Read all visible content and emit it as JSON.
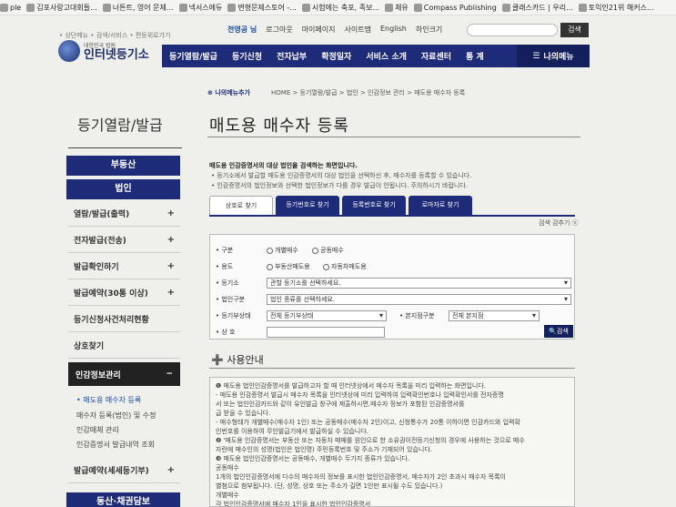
{
  "bookmarks": [
    {
      "label": "ple",
      "icon": "apple-icon"
    },
    {
      "label": "김포사랑고대회들...",
      "icon": "page-icon"
    },
    {
      "label": "너튼트, 영어 문제...",
      "icon": "page-icon"
    },
    {
      "label": "넥서스에듀",
      "icon": "globe-icon"
    },
    {
      "label": "변형문제스토어 -...",
      "icon": "globe-icon"
    },
    {
      "label": "시험에는 축포, 족보...",
      "icon": "page-icon"
    },
    {
      "label": "체유",
      "icon": "page-icon"
    },
    {
      "label": "Compass Publishing",
      "icon": "compass-icon"
    },
    {
      "label": "클래스카드 | 우리...",
      "icon": "card-icon"
    },
    {
      "label": "토익인21위 해커스...",
      "icon": "page-icon"
    }
  ],
  "header": {
    "links": [
      "전영공 님",
      "로그아웃",
      "마이페이지",
      "사이트맵",
      "English",
      "하인크기"
    ],
    "search_button": "검색",
    "small_links": "• 상단메뉴 • 검색/서비스 • 편등위로가기",
    "logo_sub": "대한민국 법원",
    "logo_title": "인터넷등기소",
    "nav": [
      "등기열람/발급",
      "등기신청",
      "전자납부",
      "확정일자",
      "서비스 소개",
      "자료센터",
      "통 계"
    ],
    "my_menu": "나의메뉴"
  },
  "sidebar": {
    "title": "등기열람/발급",
    "cat1": "부동산",
    "cat2": "법인",
    "items": [
      {
        "label": "열람/발급(출력)",
        "plus": "+"
      },
      {
        "label": "전자발급(전송)",
        "plus": "+"
      },
      {
        "label": "발급확인하기",
        "plus": "+"
      },
      {
        "label": "발급예약(30통 이상)",
        "plus": "+"
      },
      {
        "label": "등기신청사건처리현황",
        "plus": ""
      },
      {
        "label": "상호찾기",
        "plus": ""
      }
    ],
    "active_section": "인감정보관리",
    "active_minus": "−",
    "subs": [
      "• 매도용 매수자 등록",
      "매수자 등록(법인) 및 수정",
      "인감매체 관리",
      "인감증명서 발급내역 조회"
    ],
    "bottom_item": "발급예약(세세등기부)",
    "bottom_plus": "+",
    "cat3": "동산·채권담보"
  },
  "content": {
    "crumb_badge": "나의메뉴추가",
    "breadcrumb": "HOME > 등기열람/발급 > 법인 > 인감정보 관리 > 매도용 매수자 등록",
    "title": "매도용 매수자 등록",
    "lead": "매도용 인감증명서의 대상 법인을 검색하는 화면입니다.",
    "notes": [
      "• 등기소에서 발급할 매도용 인감증명서의 대상 법인을 선택하신 후, 매수자를 등록할 수 있습니다.",
      "• 인감증명서의 법인정보와 선택한 법인정보가 다를 경우 발급이 안됩니다. 주의하시기 바랍니다."
    ],
    "tabs": [
      "상호로 찾기",
      "등기번호로 찾기",
      "등록번호로 찾기",
      "로마자로 찾기"
    ],
    "collapse": "검색 감추기 ⓔ",
    "form": {
      "type_label": "• 구분",
      "type_options": [
        "개별매수",
        "공동매수"
      ],
      "use_label": "• 용도",
      "use_options": [
        "부동산매도용",
        "자동차매도용"
      ],
      "office_label": "• 등기소",
      "office_value": "관할 등기소를 선택하세요.",
      "kind_label": "• 법인구분",
      "kind_value": "법인 종류를 선택하세요.",
      "status_label": "• 등기부상태",
      "status_value": "전체 등기부상태",
      "branch_label": "• 본지점구분",
      "branch_value": "전체 본지점",
      "name_label": "• 상 호",
      "search_btn": "검색"
    },
    "guide_title": "사용안내",
    "guide_lines": [
      "❶ 매도용 법인인감증명서를 발급하고자 할 때 인터넷상에서 매수자 목록을 미리 입력하는 화면입니다.",
      "  - 매도용 인감증명서 발급시 매수자 목록을 인터넷상에 미리 입력하여 입력확인번호나 입력확인서를 전자증명",
      "    서 또는 법인인감카드와 같이 유인발급 창구에 제출하시면,매수자 정보가 포함된 인감증명서를",
      "    급 받을 수 있습니다.",
      "  - 매수형태가 개별매수(매수자 1인) 또는 공동매수(매수자 2인)이고, 신청통수가 20통 이하이면 인감카드와 입력확",
      "    인번호를 이용하여 무인발급기에서 발급하실 수 있습니다.",
      "❷ '매도용 인감증명서는 부동산 또는 자동차 매매를 원인으로 한 소유권이전등기신청의 경우에 사용하는 것으로 매수",
      "   자란에 매수인의 성명(법인은 법인명) 주민등록번호 및 주소가 기재되어 있습니다.",
      "❸ 매도용 법인인감증명서는 공동매수, 개별매수 두가지 종류가 있습니다.",
      "공동매수",
      "  1개의 법인인감증명서에 다수의 매수자의 정보를 표시한 법인인감증명서, 매수자가 2인 초과시 매수자 목록이",
      "  별첨으로 첨부됩니다. (단, 성명, 상호 또는 주소가 길면 1인만 표시될 수도 있습니다.)",
      "개별매수",
      "  각 법인인감증명서에 매수자 1인을 표시한 법인인감증명서"
    ]
  }
}
